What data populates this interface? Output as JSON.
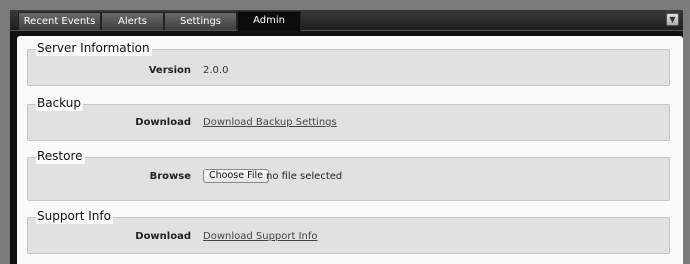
{
  "tabs": [
    {
      "label": "Recent Events",
      "active": false
    },
    {
      "label": "Alerts",
      "active": false
    },
    {
      "label": "Settings",
      "active": false
    },
    {
      "label": "Admin",
      "active": true
    }
  ],
  "collapse_icon": "chevron-down-icon",
  "sections": {
    "server_info": {
      "title": "Server Information",
      "label": "Version",
      "value": "2.0.0"
    },
    "backup": {
      "title": "Backup",
      "label": "Download",
      "link": "Download Backup Settings"
    },
    "restore": {
      "title": "Restore",
      "label": "Browse",
      "button": "Choose File",
      "status": "no file selected"
    },
    "support": {
      "title": "Support Info",
      "label": "Download",
      "link": "Download Support Info"
    }
  }
}
